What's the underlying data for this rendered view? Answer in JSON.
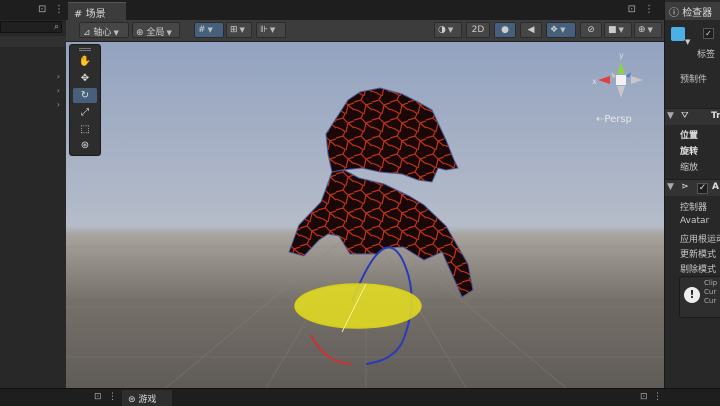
{
  "hierarchy": {
    "lock_icon": "lock-icon",
    "menu_icon": "menu-icon",
    "search_icon": "search-icon"
  },
  "scene": {
    "tab_label": "场景",
    "toolbar": {
      "pivot_label": "轴心",
      "global_label": "全局",
      "mode_2d": "2D"
    },
    "persp_label": "Persp",
    "gizmo_axes": {
      "y": "y",
      "x": "x"
    }
  },
  "game": {
    "tab_label": "游戏"
  },
  "inspector": {
    "tab_label": "检查器",
    "tag_label": "标签",
    "prefab_label": "预制件",
    "transform": {
      "title": "Tr",
      "position": "位置",
      "rotation": "旋转",
      "scale": "缩放"
    },
    "animator": {
      "title": "A",
      "controller": "控制器",
      "avatar": "Avatar",
      "apply_root_motion": "应用根运动",
      "update_mode": "更新模式",
      "culling_mode": "剔除模式",
      "help_lines": [
        "Clip",
        "Cur",
        "Cur"
      ]
    }
  },
  "colors": {
    "accent": "#46607c",
    "x_axis": "#e04040",
    "y_axis": "#8fd04f",
    "z_axis": "#4a7ad8",
    "rotate_disc": "#e8e020"
  }
}
